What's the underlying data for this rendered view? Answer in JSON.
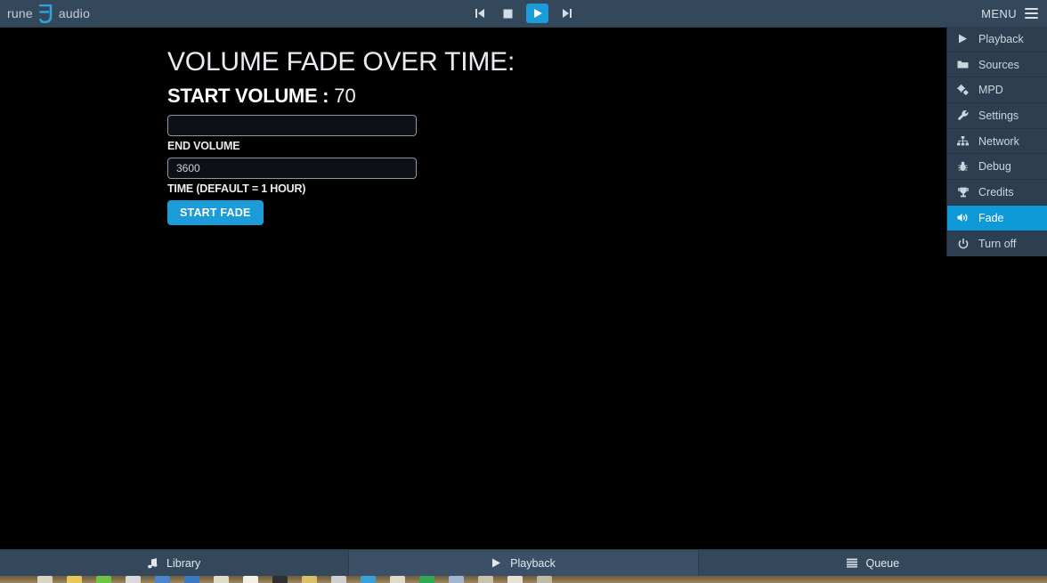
{
  "header": {
    "brand_left": "rune",
    "brand_right": "audio",
    "brand_mark_icon": "runeaudio-logo-icon",
    "transport": [
      {
        "name": "previous-track-button",
        "icon": "step-backward-icon",
        "label": "Previous"
      },
      {
        "name": "stop-button",
        "icon": "stop-icon",
        "label": "Stop"
      },
      {
        "name": "play-button",
        "icon": "play-icon",
        "label": "Play",
        "active": true
      },
      {
        "name": "next-track-button",
        "icon": "step-forward-icon",
        "label": "Next"
      }
    ],
    "menu_label": "MENU",
    "menu_icon": "hamburger-icon"
  },
  "dropdown": {
    "items": [
      {
        "label": "Playback",
        "icon": "play-icon",
        "active": false
      },
      {
        "label": "Sources",
        "icon": "folder-icon",
        "active": false
      },
      {
        "label": "MPD",
        "icon": "cogs-icon",
        "active": false
      },
      {
        "label": "Settings",
        "icon": "wrench-icon",
        "active": false
      },
      {
        "label": "Network",
        "icon": "sitemap-icon",
        "active": false
      },
      {
        "label": "Debug",
        "icon": "bug-icon",
        "active": false
      },
      {
        "label": "Credits",
        "icon": "trophy-icon",
        "active": false
      },
      {
        "label": "Fade",
        "icon": "volume-up-icon",
        "active": true
      },
      {
        "label": "Turn off",
        "icon": "power-icon",
        "active": false
      }
    ]
  },
  "main": {
    "page_title": "VOLUME FADE OVER TIME:",
    "start_volume_label": "START VOLUME :",
    "start_volume_value": "70",
    "end_volume": {
      "value": "",
      "placeholder": "",
      "label": "END VOLUME"
    },
    "time": {
      "value": "3600",
      "placeholder": "",
      "label": "TIME (DEFAULT = 1 HOUR)"
    },
    "start_fade_label": "START FADE"
  },
  "bottom_nav": {
    "items": [
      {
        "label": "Library",
        "icon": "music-note-icon",
        "active": false
      },
      {
        "label": "Playback",
        "icon": "play-icon",
        "active": true
      },
      {
        "label": "Queue",
        "icon": "list-icon",
        "active": false
      }
    ]
  },
  "colors": {
    "accent": "#1b9bd8",
    "menu_highlight": "#0e9ad8",
    "chrome": "#34485c",
    "menu_bg": "#2c3e50",
    "content_bg": "#000000"
  }
}
